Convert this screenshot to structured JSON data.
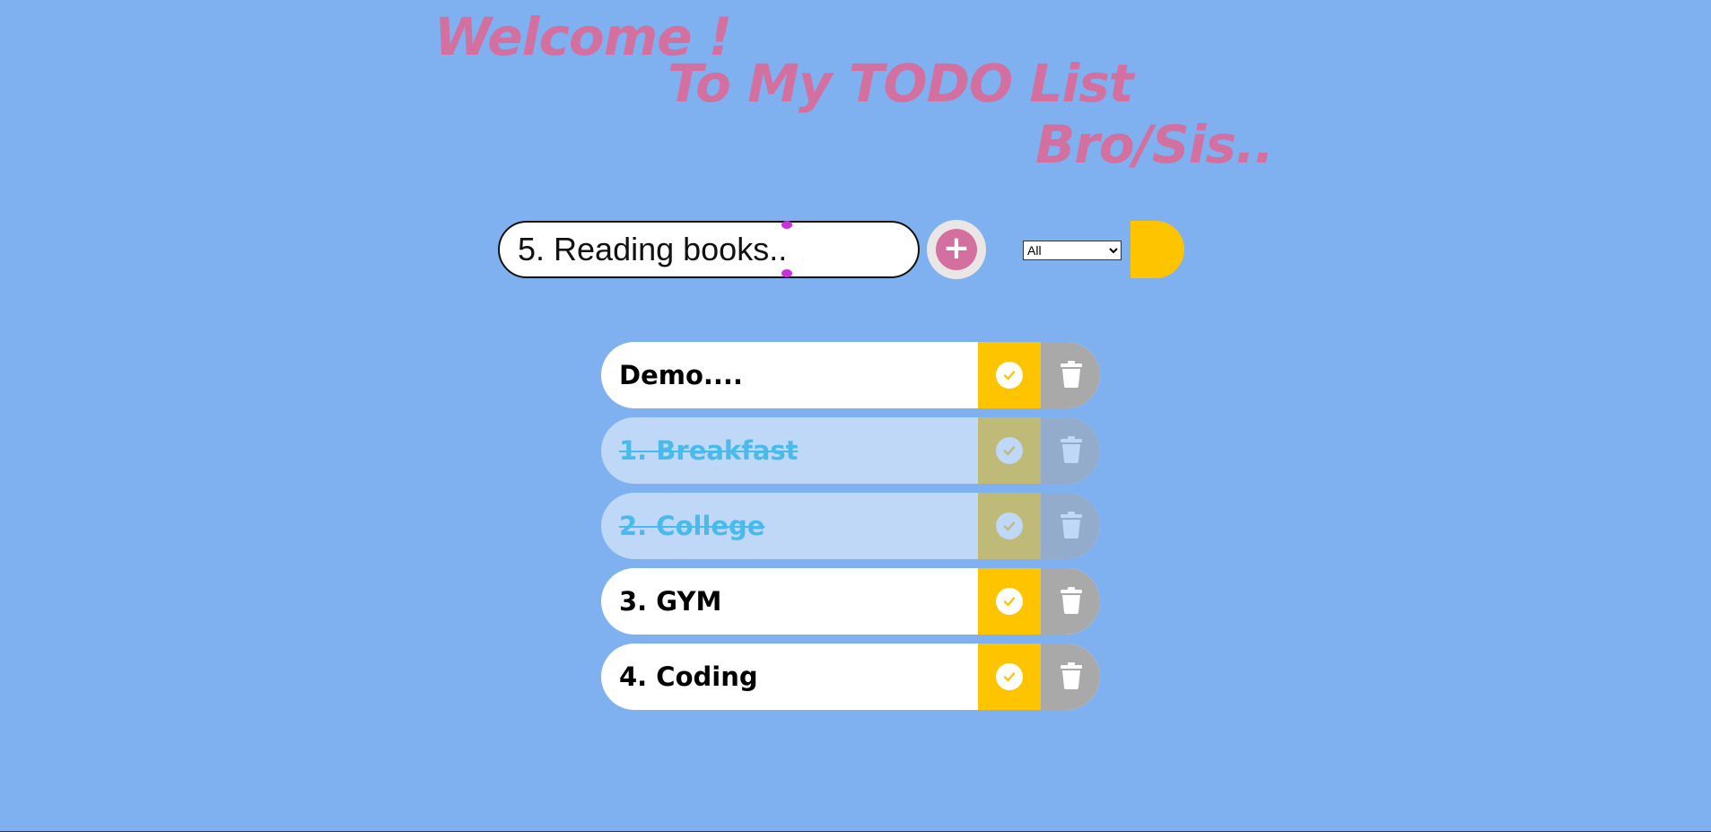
{
  "header": {
    "line1": "Welcome !",
    "line2": "To My TODO List",
    "line3": "Bro/Sis.."
  },
  "form": {
    "input_value": "5. Reading books..",
    "add_label": "+",
    "filter_options": [
      "All"
    ],
    "filter_selected": "All"
  },
  "todos": [
    {
      "text": "Demo....",
      "completed": false
    },
    {
      "text": "1. Breakfast",
      "completed": true
    },
    {
      "text": "2. College",
      "completed": true
    },
    {
      "text": "3. GYM",
      "completed": false
    },
    {
      "text": "4. Coding",
      "completed": false
    }
  ],
  "colors": {
    "background": "#7fb1f0",
    "heading": "#d4709f",
    "add_button": "#d4709f",
    "check_bg": "#ffc400",
    "trash_bg": "#a9a9a9",
    "completed_text": "#17c4e8"
  },
  "icons": {
    "add": "plus-icon",
    "check": "check-icon",
    "trash": "trash-icon",
    "filter": "chevron-down-icon"
  }
}
